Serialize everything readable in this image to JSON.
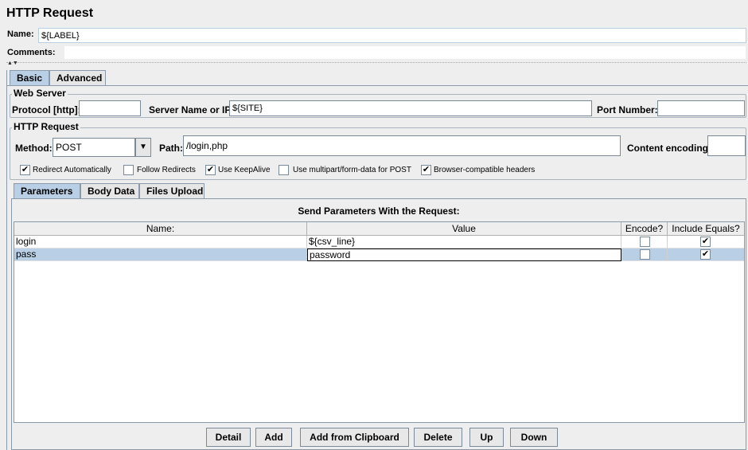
{
  "header": {
    "title": "HTTP Request"
  },
  "name_row": {
    "label": "Name:",
    "value": "${LABEL}"
  },
  "comments_row": {
    "label": "Comments:"
  },
  "main_tabs": [
    {
      "label": "Basic",
      "active": true
    },
    {
      "label": "Advanced",
      "active": false
    }
  ],
  "web_server": {
    "legend": "Web Server",
    "protocol_label": "Protocol [http]:",
    "protocol_value": "",
    "server_label": "Server Name or IP:",
    "server_value": "${SITE}",
    "port_label": "Port Number:",
    "port_value": ""
  },
  "http_request": {
    "legend": "HTTP Request",
    "method_label": "Method:",
    "method_value": "POST",
    "path_label": "Path:",
    "path_value": "/login,php",
    "encoding_label": "Content encoding:",
    "encoding_value": ""
  },
  "options": [
    {
      "label": "Redirect Automatically",
      "checked": true
    },
    {
      "label": "Follow Redirects",
      "checked": false
    },
    {
      "label": "Use KeepAlive",
      "checked": true
    },
    {
      "label": "Use multipart/form-data for POST",
      "checked": false
    },
    {
      "label": "Browser-compatible headers",
      "checked": true
    }
  ],
  "sub_tabs": [
    {
      "label": "Parameters",
      "active": true
    },
    {
      "label": "Body Data",
      "active": false
    },
    {
      "label": "Files Upload",
      "active": false
    }
  ],
  "params": {
    "title": "Send Parameters With the Request:",
    "columns": [
      "Name:",
      "Value",
      "Encode?",
      "Include Equals?"
    ],
    "rows": [
      {
        "name": "login",
        "value": "${csv_line}",
        "encode": false,
        "include_equals": true,
        "selected": false
      },
      {
        "name": "pass",
        "value": "password",
        "encode": false,
        "include_equals": true,
        "selected": true
      }
    ]
  },
  "buttons": {
    "detail": "Detail",
    "add": "Add",
    "add_clipboard": "Add from Clipboard",
    "delete": "Delete",
    "up": "Up",
    "down": "Down"
  },
  "icons": {
    "check": "✔",
    "dropdown": "▼",
    "split": "▲▼"
  }
}
